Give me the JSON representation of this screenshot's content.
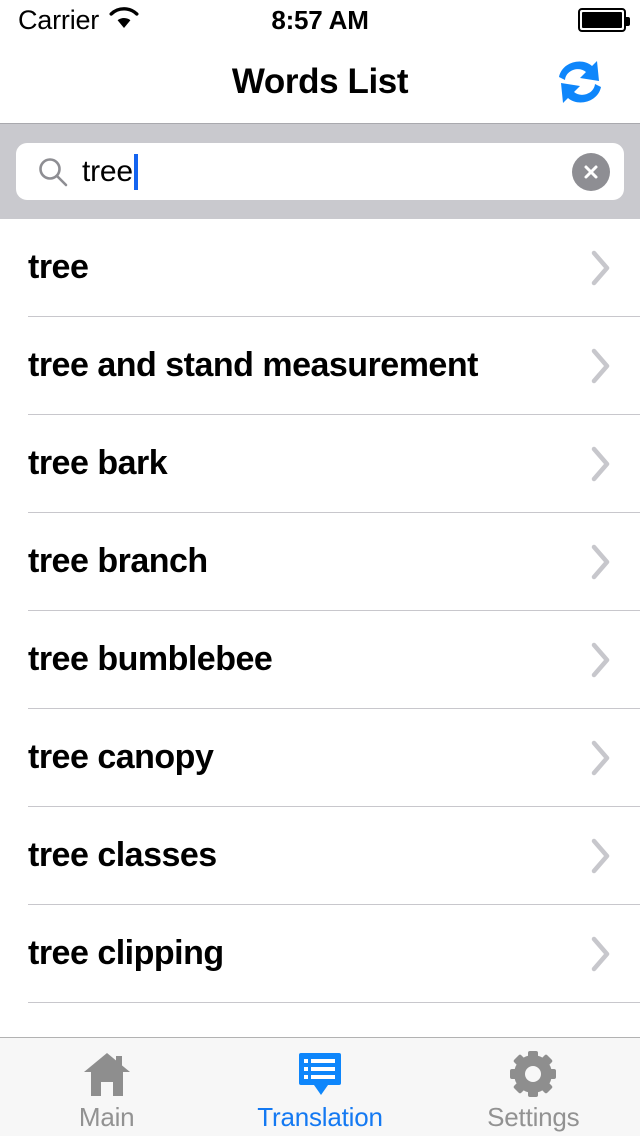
{
  "status_bar": {
    "carrier": "Carrier",
    "wifi_icon": "wifi-icon",
    "time": "8:57 AM",
    "battery_icon": "battery-full-icon"
  },
  "nav_bar": {
    "title": "Words List",
    "refresh_icon": "swap-refresh-arrows-icon"
  },
  "search": {
    "value": "tree",
    "placeholder": "Search",
    "search_icon": "search-magnifier-icon",
    "clear_icon": "clear-circle-x-icon"
  },
  "list": {
    "disclosure_icon": "chevron-right-icon",
    "rows": [
      {
        "label": "tree"
      },
      {
        "label": "tree and stand measurement"
      },
      {
        "label": "tree bark"
      },
      {
        "label": "tree branch"
      },
      {
        "label": "tree bumblebee"
      },
      {
        "label": "tree canopy"
      },
      {
        "label": "tree classes"
      },
      {
        "label": "tree clipping"
      }
    ]
  },
  "tab_bar": {
    "tabs": [
      {
        "label": "Main",
        "icon": "home-house-icon",
        "active": false
      },
      {
        "label": "Translation",
        "icon": "speech-list-icon",
        "active": true
      },
      {
        "label": "Settings",
        "icon": "gear-icon",
        "active": false
      }
    ]
  },
  "colors": {
    "accent_blue": "#1479f2",
    "refresh_blue": "#0e86fb",
    "search_bg": "#c9c9ce",
    "separator": "#c8c7cc",
    "tab_inactive": "#929292",
    "tab_bar_bg": "#f7f7f7"
  }
}
